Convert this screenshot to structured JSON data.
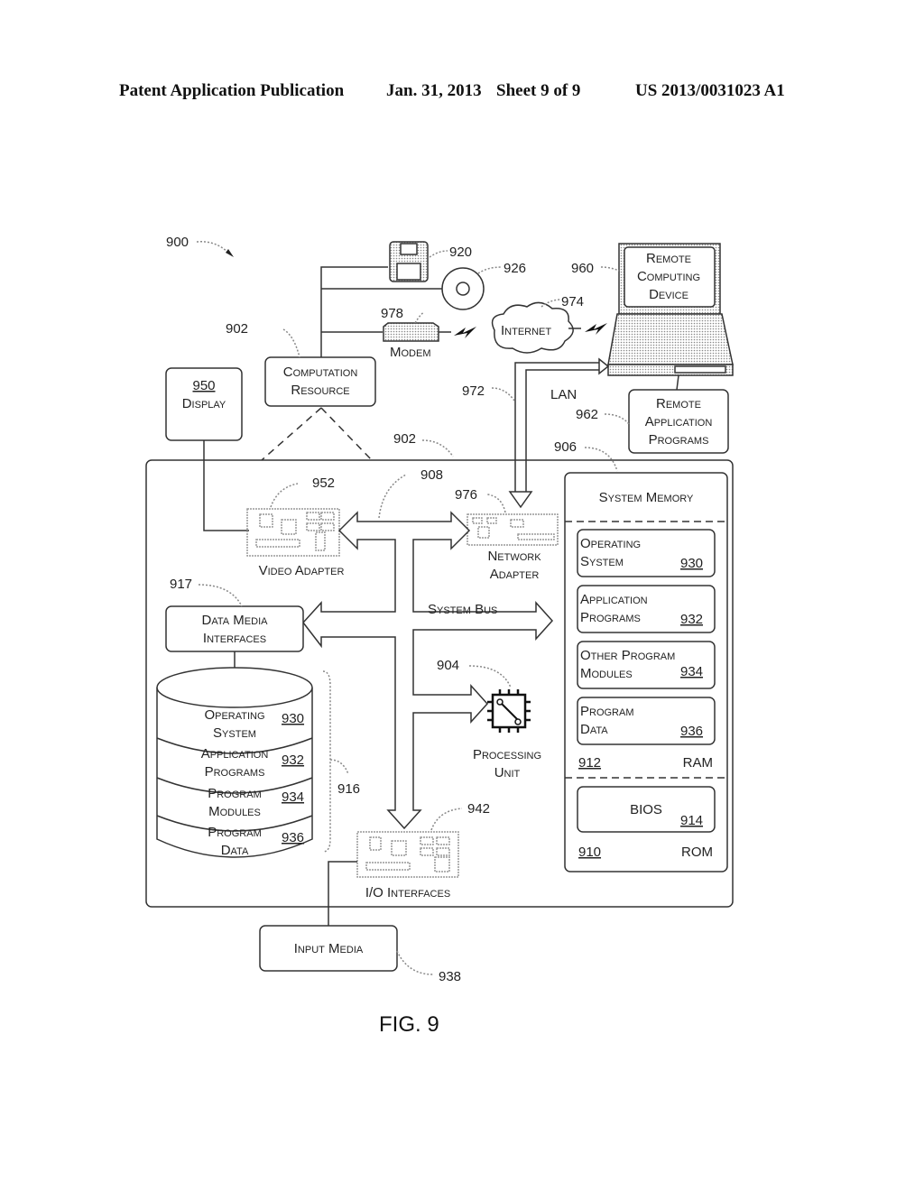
{
  "header": {
    "publication": "Patent Application Publication",
    "date": "Jan. 31, 2013",
    "sheet": "Sheet 9 of 9",
    "number": "US 2013/0031023 A1"
  },
  "figure_label": "FIG. 9",
  "refs": {
    "system": "900",
    "computation_resource_outer": "902",
    "computation_resource_inner": "902",
    "floppy": "920",
    "disc": "926",
    "modem": "978",
    "internet": "974",
    "remote_device": "960",
    "lan": "972",
    "remote_apps": "962",
    "system_memory": "906",
    "display": "950",
    "video_adapter": "952",
    "bus": "908",
    "network_adapter": "976",
    "data_media": "917",
    "processing_unit": "904",
    "storage_group": "916",
    "io_interfaces": "942",
    "input_media": "938",
    "ram": "912",
    "rom": "910",
    "bios": "914"
  },
  "labels": {
    "modem": "Modem",
    "internet": "Internet",
    "remote_device": [
      "Remote",
      "Computing",
      "Device"
    ],
    "remote_apps": [
      "Remote",
      "Application",
      "Programs"
    ],
    "lan": "LAN",
    "computation_resource": [
      "Computation",
      "Resource"
    ],
    "display": "Display",
    "video_adapter": "Video Adapter",
    "network_adapter": [
      "Network",
      "Adapter"
    ],
    "data_media": [
      "Data Media",
      "Interfaces"
    ],
    "system_bus": "System Bus",
    "processing_unit": [
      "Processing",
      "Unit"
    ],
    "io_interfaces": "I/O Interfaces",
    "input_media": "Input Media",
    "system_memory": "System Memory",
    "ram": "RAM",
    "rom": "ROM",
    "bios": "BIOS"
  },
  "memory_items": [
    {
      "line1": "Operating",
      "line2": "System",
      "ref": "930"
    },
    {
      "line1": "Application",
      "line2": "Programs",
      "ref": "932"
    },
    {
      "line1": "Other Program",
      "line2": "Modules",
      "ref": "934"
    },
    {
      "line1": "Program",
      "line2": "Data",
      "ref": "936"
    }
  ],
  "disk_items": [
    {
      "line1": "Operating",
      "line2": "System",
      "ref": "930"
    },
    {
      "line1": "Application",
      "line2": "Programs",
      "ref": "932"
    },
    {
      "line1": "Program",
      "line2": "Modules",
      "ref": "934"
    },
    {
      "line1": "Program",
      "line2": "Data",
      "ref": "936"
    }
  ]
}
